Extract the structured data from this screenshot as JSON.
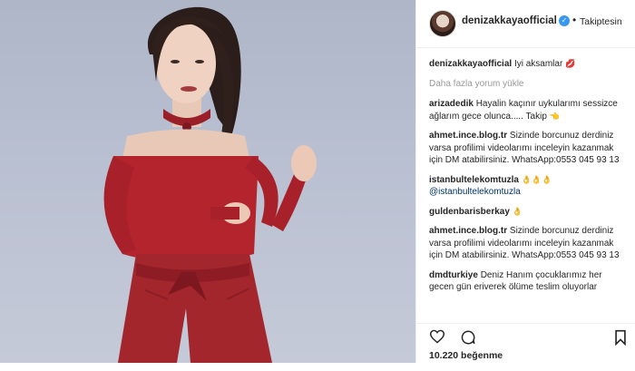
{
  "post": {
    "username": "denizakkayaofficial",
    "follow_status": "Takiptesin",
    "likes_count": "10.220",
    "likes_label": "beğenme"
  },
  "caption": {
    "user": "denizakkayaofficial",
    "text": "Iyi aksamlar"
  },
  "load_more": "Daha fazla yorum yükle",
  "comments": [
    {
      "user": "arizadedik",
      "text": "Hayalin kaçınır uykularımı sessizce ağlarım gece olunca..... Takip"
    },
    {
      "user": "ahmet.ince.blog.tr",
      "text": "Sizinde borcunuz derdiniz varsa profilimi videolarımı inceleyin kazanmak için DM atabilirsiniz. WhatsApp:0553 045 93 13"
    },
    {
      "user": "istanbultelekomtuzla",
      "text": "",
      "mention": "@istanbultelekomtuzla"
    },
    {
      "user": "guldenbarisberkay",
      "text": ""
    },
    {
      "user": "ahmet.ince.blog.tr",
      "text": "Sizinde borcunuz derdiniz varsa profilimi videolarımı inceleyin kazanmak için DM atabilirsiniz. WhatsApp:0553 045 93 13"
    },
    {
      "user": "dmdturkiye",
      "text": "Deniz Hanım çocuklarımız her gecen gün eriverek ölüme teslim oluyorlar"
    }
  ],
  "icons": {
    "verified": "verified-badge-icon",
    "like": "heart-icon",
    "comment": "comment-bubble-icon",
    "save": "bookmark-icon"
  },
  "colors": {
    "verified_blue": "#3897f0",
    "dress_red": "#b4242c",
    "background": "#b9c0d1"
  }
}
